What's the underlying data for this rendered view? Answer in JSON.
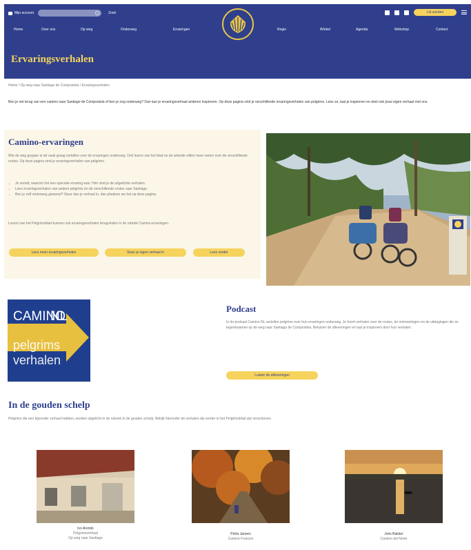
{
  "header": {
    "account_label": "Mijn account",
    "search_label": "Zoek",
    "lid_button": "Lid worden",
    "title": "Ervaringsverhalen",
    "nav_left": [
      "Home",
      "Over ons",
      "Op weg",
      "Onderweg",
      "Ervaringen"
    ],
    "nav_right": [
      "Regio",
      "Winkel",
      "Agenda",
      "Webshop",
      "Contact"
    ]
  },
  "breadcrumb": "Home / Op weg naar Santiago de Compostela / Ervaringsverhalen",
  "intro": "Ben je net terug van een camino naar Santiago de Compostela of ben je nog onderweg? Dan kan je ervaringsverhaal anderen inspireren. Op deze pagina vind je verschillende ervaringsverhalen van pelgrims. Lees ze, laat je inspireren en deel ook jouw eigen verhaal met ons.",
  "camino": {
    "heading": "Camino-ervaringen",
    "para1": "Wie de weg gegaan is wil vaak graag vertellen over de ervaringen onderweg. Ook lezers van het blad en de website willen meer weten over de verschillende routes. Op deze pagina vind je ervaringsverhalen van pelgrims.",
    "list": [
      "Je vertelt, waarom het een speciale ervaring was. Hier vind je de uitgelichte verhalen.",
      "Lees ervaringsverhalen van andere pelgrims en de verschillende routes naar Santiago.",
      "Ben je zelf onderweg geweest? Stuur dan je verhaal in, dan plaatsen we het op deze pagina."
    ],
    "para2": "Lezers van het Pelgrimsblad kunnen ook ervaringsverhalen terugvinden in de rubriek Camino-ervaringen.",
    "buttons": [
      "Lees meer ervaringsverhalen",
      "Stuur je eigen verhaal in",
      "Lees verder"
    ]
  },
  "logo_image": {
    "line1": "CAMINO",
    "line2": "NL",
    "line3": "pelgrims",
    "line4": "verhalen"
  },
  "podcast": {
    "heading": "Podcast",
    "para": "In de podcast Camino NL vertellen pelgrims over hun ervaringen onderweg. Je hoort verhalen over de routes, de ontmoetingen en de uitdagingen die ze tegenkwamen op de weg naar Santiago de Compostela. Beluister de afleveringen en laat je inspireren door hun verhalen.",
    "button": "Luister de afleveringen"
  },
  "gouden": {
    "heading": "In de gouden schelp",
    "para": "Pelgrims die een bijzonder verhaal hebben, worden uitgelicht in de rubriek In de gouden schelp. Bekijk hieronder de verhalen die eerder in het Pelgrimsblad zijn verschenen."
  },
  "thumbs": [
    {
      "name": "Ivo Arends",
      "line1": "Pelgrimsverhaal",
      "line2": "Op weg naar Santiago"
    },
    {
      "name": "Petra Jansen",
      "line1": "Camino Frances"
    },
    {
      "name": "Joris Bakker",
      "line1": "Camino del Norte"
    }
  ],
  "colors": {
    "primary": "#2f3f8c",
    "accent": "#f5d35c",
    "cream": "#fbf6e8"
  }
}
